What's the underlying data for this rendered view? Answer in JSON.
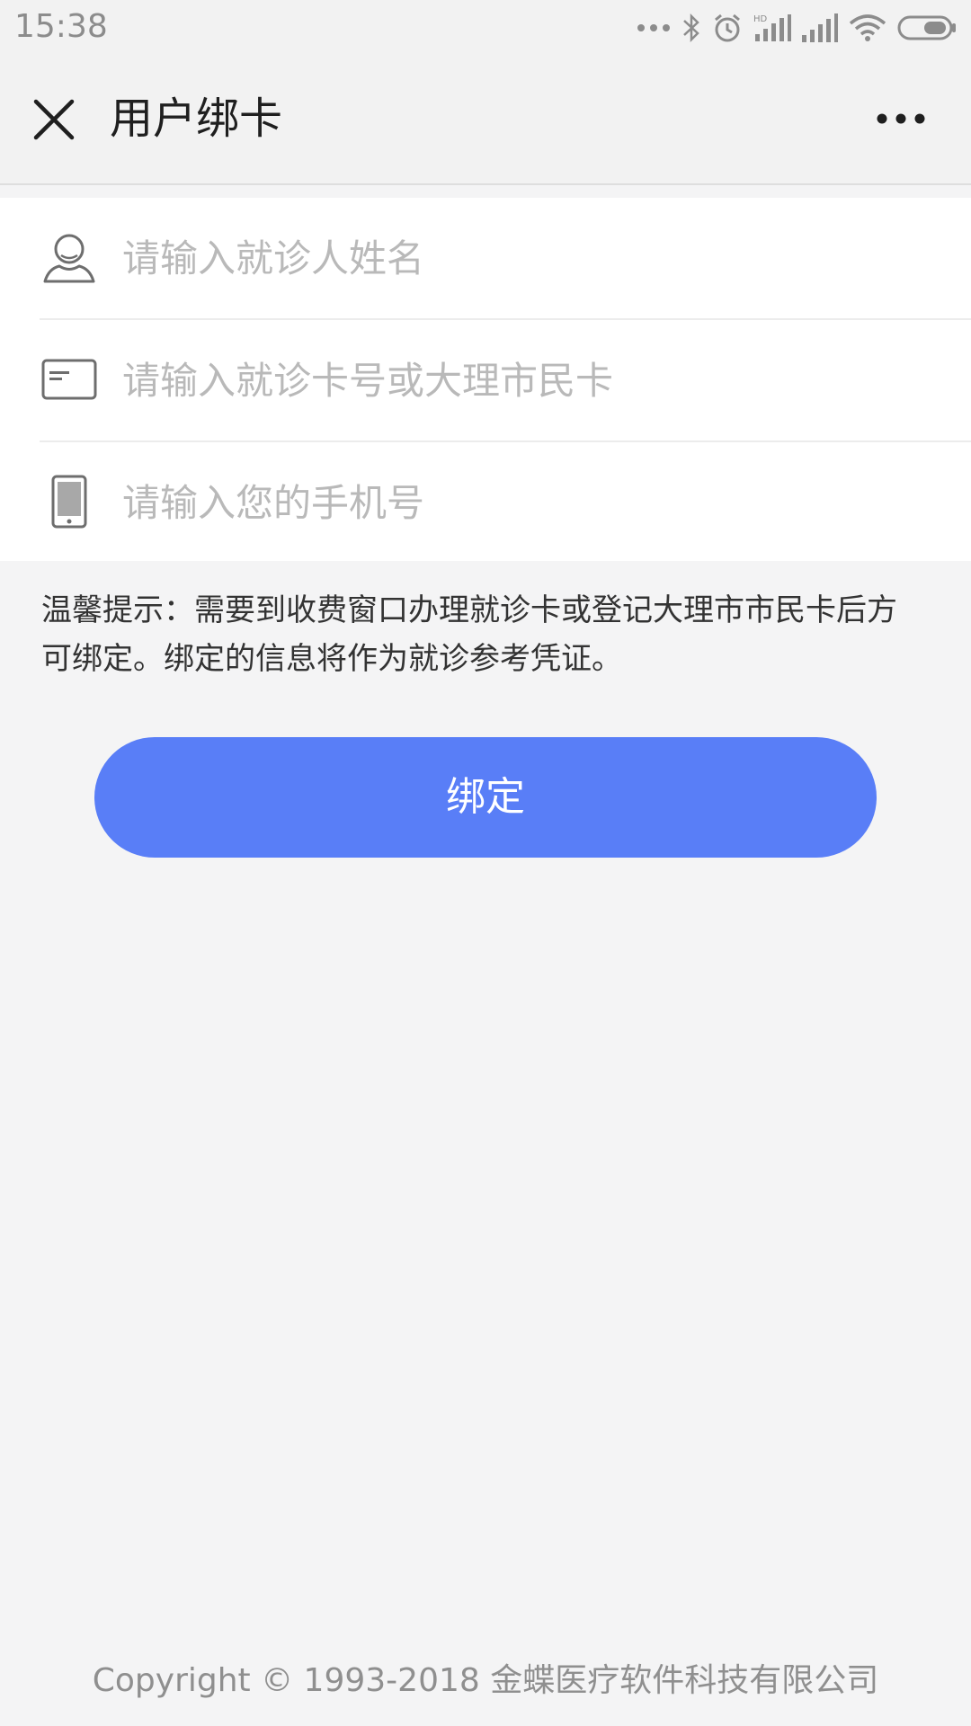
{
  "status_bar": {
    "time": "15:38",
    "icons": [
      "more-dots-icon",
      "bluetooth-icon",
      "alarm-icon",
      "hd-signal-icon",
      "signal-icon",
      "wifi-icon",
      "battery-icon"
    ]
  },
  "nav": {
    "title": "用户绑卡",
    "close_icon": "close-icon",
    "more_icon": "more-icon"
  },
  "form": {
    "name_placeholder": "请输入就诊人姓名",
    "card_placeholder": "请输入就诊卡号或大理市民卡",
    "phone_placeholder": "请输入您的手机号",
    "name_value": "",
    "card_value": "",
    "phone_value": ""
  },
  "tip": "温馨提示：需要到收费窗口办理就诊卡或登记大理市市民卡后方可绑定。绑定的信息将作为就诊参考凭证。",
  "bind_button_label": "绑定",
  "footer": {
    "copyright": "Copyright © 1993-2018 金蝶医疗软件科技有限公司"
  },
  "colors": {
    "accent": "#597ef7",
    "background": "#f4f4f5",
    "placeholder": "#b9b9b9"
  }
}
